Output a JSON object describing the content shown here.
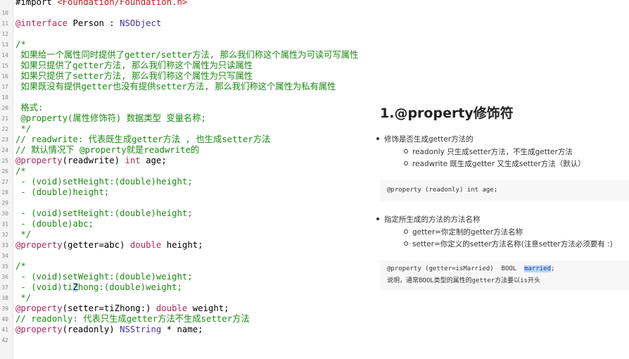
{
  "editor": {
    "lines": [
      {
        "n": "",
        "parts": [
          {
            "t": "#import ",
            "c": "plain"
          },
          {
            "t": "<Foundation/Foundation.h>",
            "c": "string"
          }
        ]
      },
      {
        "n": "10",
        "parts": []
      },
      {
        "n": "11",
        "parts": [
          {
            "t": "@interface",
            "c": "keyword"
          },
          {
            "t": " Person : ",
            "c": "plain"
          },
          {
            "t": "NSObject",
            "c": "type"
          }
        ]
      },
      {
        "n": "12",
        "parts": []
      },
      {
        "n": "13",
        "parts": [
          {
            "t": "/*",
            "c": "comment"
          }
        ]
      },
      {
        "n": "14",
        "parts": [
          {
            "t": " 如果给一个属性同时提供了getter/setter方法, 那么我们称这个属性为可读可写属性",
            "c": "comment"
          }
        ]
      },
      {
        "n": "15",
        "parts": [
          {
            "t": " 如果只提供了getter方法, 那么我们称这个属性为只读属性",
            "c": "comment"
          }
        ]
      },
      {
        "n": "16",
        "parts": [
          {
            "t": " 如果只提供了setter方法, 那么我们称这个属性为只写属性",
            "c": "comment"
          }
        ]
      },
      {
        "n": "17",
        "parts": [
          {
            "t": " 如果既没有提供getter也没有提供setter方法, 那么我们称这个属性为私有属性",
            "c": "comment"
          }
        ]
      },
      {
        "n": "18",
        "parts": []
      },
      {
        "n": "20",
        "parts": [
          {
            "t": " 格式:",
            "c": "comment"
          }
        ]
      },
      {
        "n": "21",
        "parts": [
          {
            "t": " @property(属性修饰符) 数据类型 变量名称;",
            "c": "comment"
          }
        ]
      },
      {
        "n": "22",
        "parts": [
          {
            "t": " */",
            "c": "comment"
          }
        ]
      },
      {
        "n": "23",
        "parts": [
          {
            "t": "// readwrite: 代表既生成getter方法 , 也生成setter方法",
            "c": "comment"
          }
        ]
      },
      {
        "n": "24",
        "parts": [
          {
            "t": "// 默认情况下 @property就是readwrite的",
            "c": "comment"
          }
        ]
      },
      {
        "n": "25",
        "parts": [
          {
            "t": "@property",
            "c": "keyword"
          },
          {
            "t": "(readwrite) ",
            "c": "plain"
          },
          {
            "t": "int",
            "c": "keyword"
          },
          {
            "t": " age;",
            "c": "plain"
          }
        ]
      },
      {
        "n": "26",
        "parts": [
          {
            "t": "/*",
            "c": "comment"
          }
        ]
      },
      {
        "n": "27",
        "parts": [
          {
            "t": " - (void)setHeight:(double)height;",
            "c": "comment"
          }
        ]
      },
      {
        "n": "28",
        "parts": [
          {
            "t": " - (double)height;",
            "c": "comment"
          }
        ]
      },
      {
        "n": "29",
        "parts": []
      },
      {
        "n": "30",
        "parts": [
          {
            "t": " - (void)setHeight:(double)height;",
            "c": "comment"
          }
        ]
      },
      {
        "n": "31",
        "parts": [
          {
            "t": " - (double)abc;",
            "c": "comment"
          }
        ]
      },
      {
        "n": "32",
        "parts": [
          {
            "t": " */",
            "c": "comment"
          }
        ]
      },
      {
        "n": "33",
        "parts": [
          {
            "t": "@property",
            "c": "keyword"
          },
          {
            "t": "(getter=abc) ",
            "c": "plain"
          },
          {
            "t": "double",
            "c": "keyword"
          },
          {
            "t": " height;",
            "c": "plain"
          }
        ]
      },
      {
        "n": "34",
        "parts": []
      },
      {
        "n": "35",
        "parts": [
          {
            "t": "/*",
            "c": "comment"
          }
        ]
      },
      {
        "n": "36",
        "parts": [
          {
            "t": " - (void)setWeight:(double)weight;",
            "c": "comment"
          }
        ]
      },
      {
        "n": "37",
        "parts": [
          {
            "t": " - (void)ti",
            "c": "comment"
          },
          {
            "t": "Z",
            "c": "cursor"
          },
          {
            "t": "hong:(double)weight;",
            "c": "comment"
          }
        ]
      },
      {
        "n": "38",
        "parts": [
          {
            "t": " */",
            "c": "comment"
          }
        ]
      },
      {
        "n": "39",
        "parts": [
          {
            "t": "@property",
            "c": "keyword"
          },
          {
            "t": "(setter=tiZhong:) ",
            "c": "plain"
          },
          {
            "t": "double",
            "c": "keyword"
          },
          {
            "t": " weight;",
            "c": "plain"
          }
        ]
      },
      {
        "n": "40",
        "parts": [
          {
            "t": "// readonly: 代表只生成getter方法不生成setter方法",
            "c": "comment"
          }
        ]
      },
      {
        "n": "41",
        "parts": [
          {
            "t": "@property",
            "c": "keyword"
          },
          {
            "t": "(readonly) ",
            "c": "plain"
          },
          {
            "t": "NSString",
            "c": "type"
          },
          {
            "t": " * name;",
            "c": "plain"
          }
        ]
      },
      {
        "n": "42",
        "parts": []
      }
    ]
  },
  "doc": {
    "title": "1.@property修饰符",
    "bullet1": "修饰是否生成getter方法的",
    "bullet1_sub1": "readonly 只生成setter方法，不生成getter方法",
    "bullet1_sub2": "readwrite 既生成getter 又生成setter方法（默认）",
    "code1": "@property (readonly) int age;",
    "bullet2": "指定所生成的方法的方法名称",
    "bullet2_sub1": "getter=你定制的getter方法名称",
    "bullet2_sub2": "setter=你定义的setter方法名称(注意setter方法必须要有 :)",
    "code2_prefix": "@property (getter=isMarried)  BOOL  ",
    "code2_highlight": "married",
    "code2_suffix": ";",
    "code2_note": "说明，通常BOOL类型的属性的getter方法要以is开头"
  },
  "colors": {
    "comment": "#1c8a14",
    "keyword": "#b0285f",
    "string": "#c41a16",
    "type": "#4b2fa8",
    "highlight": "#b7d6f5"
  }
}
